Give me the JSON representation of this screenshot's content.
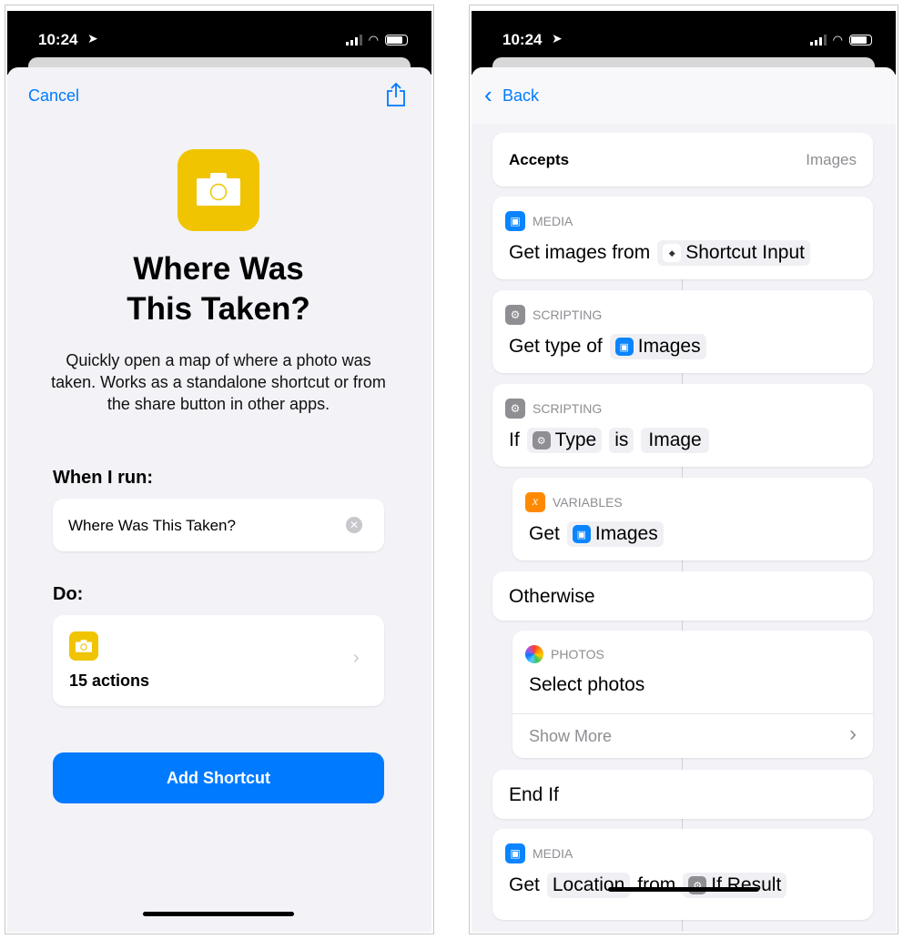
{
  "status_bar": {
    "time": "10:24"
  },
  "left": {
    "cancel": "Cancel",
    "title_line1": "Where Was",
    "title_line2": "This Taken?",
    "description": "Quickly open a map of where a photo was taken. Works as a standalone shortcut or from the share button in other apps.",
    "when_label": "When I run:",
    "name_value": "Where Was This Taken?",
    "do_label": "Do:",
    "actions_count": "15 actions",
    "add_button": "Add Shortcut",
    "accent": "#007aff",
    "icon_color": "#f0c400"
  },
  "right": {
    "back": "Back",
    "accepts_label": "Accepts",
    "accepts_value": "Images",
    "actions": [
      {
        "category": "MEDIA",
        "text": "Get images from",
        "token": "Shortcut Input"
      },
      {
        "category": "SCRIPTING",
        "text": "Get type of",
        "token": "Images"
      },
      {
        "category": "SCRIPTING",
        "text": "If",
        "token": "Type",
        "op": "is",
        "value": "Image"
      },
      {
        "category": "VARIABLES",
        "text": "Get",
        "token": "Images"
      },
      {
        "text": "Otherwise"
      },
      {
        "category": "PHOTOS",
        "text": "Select photos",
        "more": "Show More"
      },
      {
        "text": "End If"
      },
      {
        "category": "MEDIA",
        "text": "Get",
        "token": "Location",
        "mid": "from",
        "token2": "If Result"
      }
    ]
  }
}
